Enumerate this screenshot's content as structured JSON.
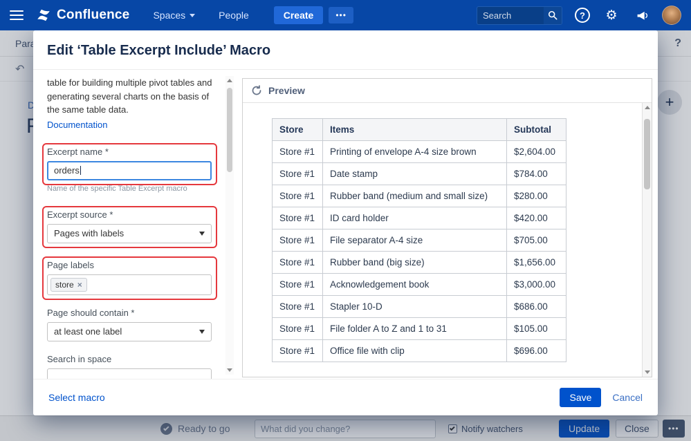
{
  "navbar": {
    "logo_text": "Confluence",
    "spaces_label": "Spaces",
    "people_label": "People",
    "create_label": "Create",
    "more_label": "•••",
    "search_placeholder": "Search"
  },
  "icons": {
    "help_glyph": "?",
    "gear_glyph": "⚙",
    "undo_glyph": "↶",
    "plus_glyph": "+",
    "chip_remove_glyph": "×"
  },
  "editor_bg": {
    "toolbar_text": "Para",
    "help_glyph": "?",
    "breadcrumb_fragment": "D",
    "title_fragment": "F"
  },
  "statusbar": {
    "ready_label": "Ready to go",
    "change_placeholder": "What did you change?",
    "notify_label": "Notify watchers",
    "update_label": "Update",
    "close_label": "Close",
    "more_label": "•••"
  },
  "modal": {
    "title": "Edit ‘Table Excerpt Include’ Macro",
    "form": {
      "description": "table for building multiple pivot tables and generating several charts on the basis of the same table data.",
      "documentation_label": "Documentation",
      "excerpt_name_label": "Excerpt name *",
      "excerpt_name_value": "orders",
      "excerpt_name_help": "Name of the specific Table Excerpt macro",
      "excerpt_source_label": "Excerpt source *",
      "excerpt_source_value": "Pages with labels",
      "page_labels_label": "Page labels",
      "page_label_chip": "store",
      "page_contain_label": "Page should contain *",
      "page_contain_value": "at least one label",
      "search_space_label": "Search in space"
    },
    "preview": {
      "title": "Preview",
      "table": {
        "headers": [
          "Store",
          "Items",
          "Subtotal"
        ],
        "rows": [
          [
            "Store #1",
            "Printing of envelope A-4 size brown",
            "$2,604.00"
          ],
          [
            "Store #1",
            "Date stamp",
            "$784.00"
          ],
          [
            "Store #1",
            "Rubber band (medium and small size)",
            "$280.00"
          ],
          [
            "Store #1",
            "ID card holder",
            "$420.00"
          ],
          [
            "Store #1",
            "File separator A-4 size",
            "$705.00"
          ],
          [
            "Store #1",
            "Rubber band (big size)",
            "$1,656.00"
          ],
          [
            "Store #1",
            "Acknowledgement book",
            "$3,000.00"
          ],
          [
            "Store #1",
            "Stapler 10-D",
            "$686.00"
          ],
          [
            "Store #1",
            "File folder A to Z and 1 to 31",
            "$105.00"
          ],
          [
            "Store #1",
            "Office file with clip",
            "$696.00"
          ]
        ]
      }
    },
    "footer": {
      "select_macro_label": "Select macro",
      "save_label": "Save",
      "cancel_label": "Cancel"
    }
  },
  "colors": {
    "navbar": "#0747a6",
    "accent_blue": "#0052cc",
    "annotation_red": "#e5383d"
  }
}
